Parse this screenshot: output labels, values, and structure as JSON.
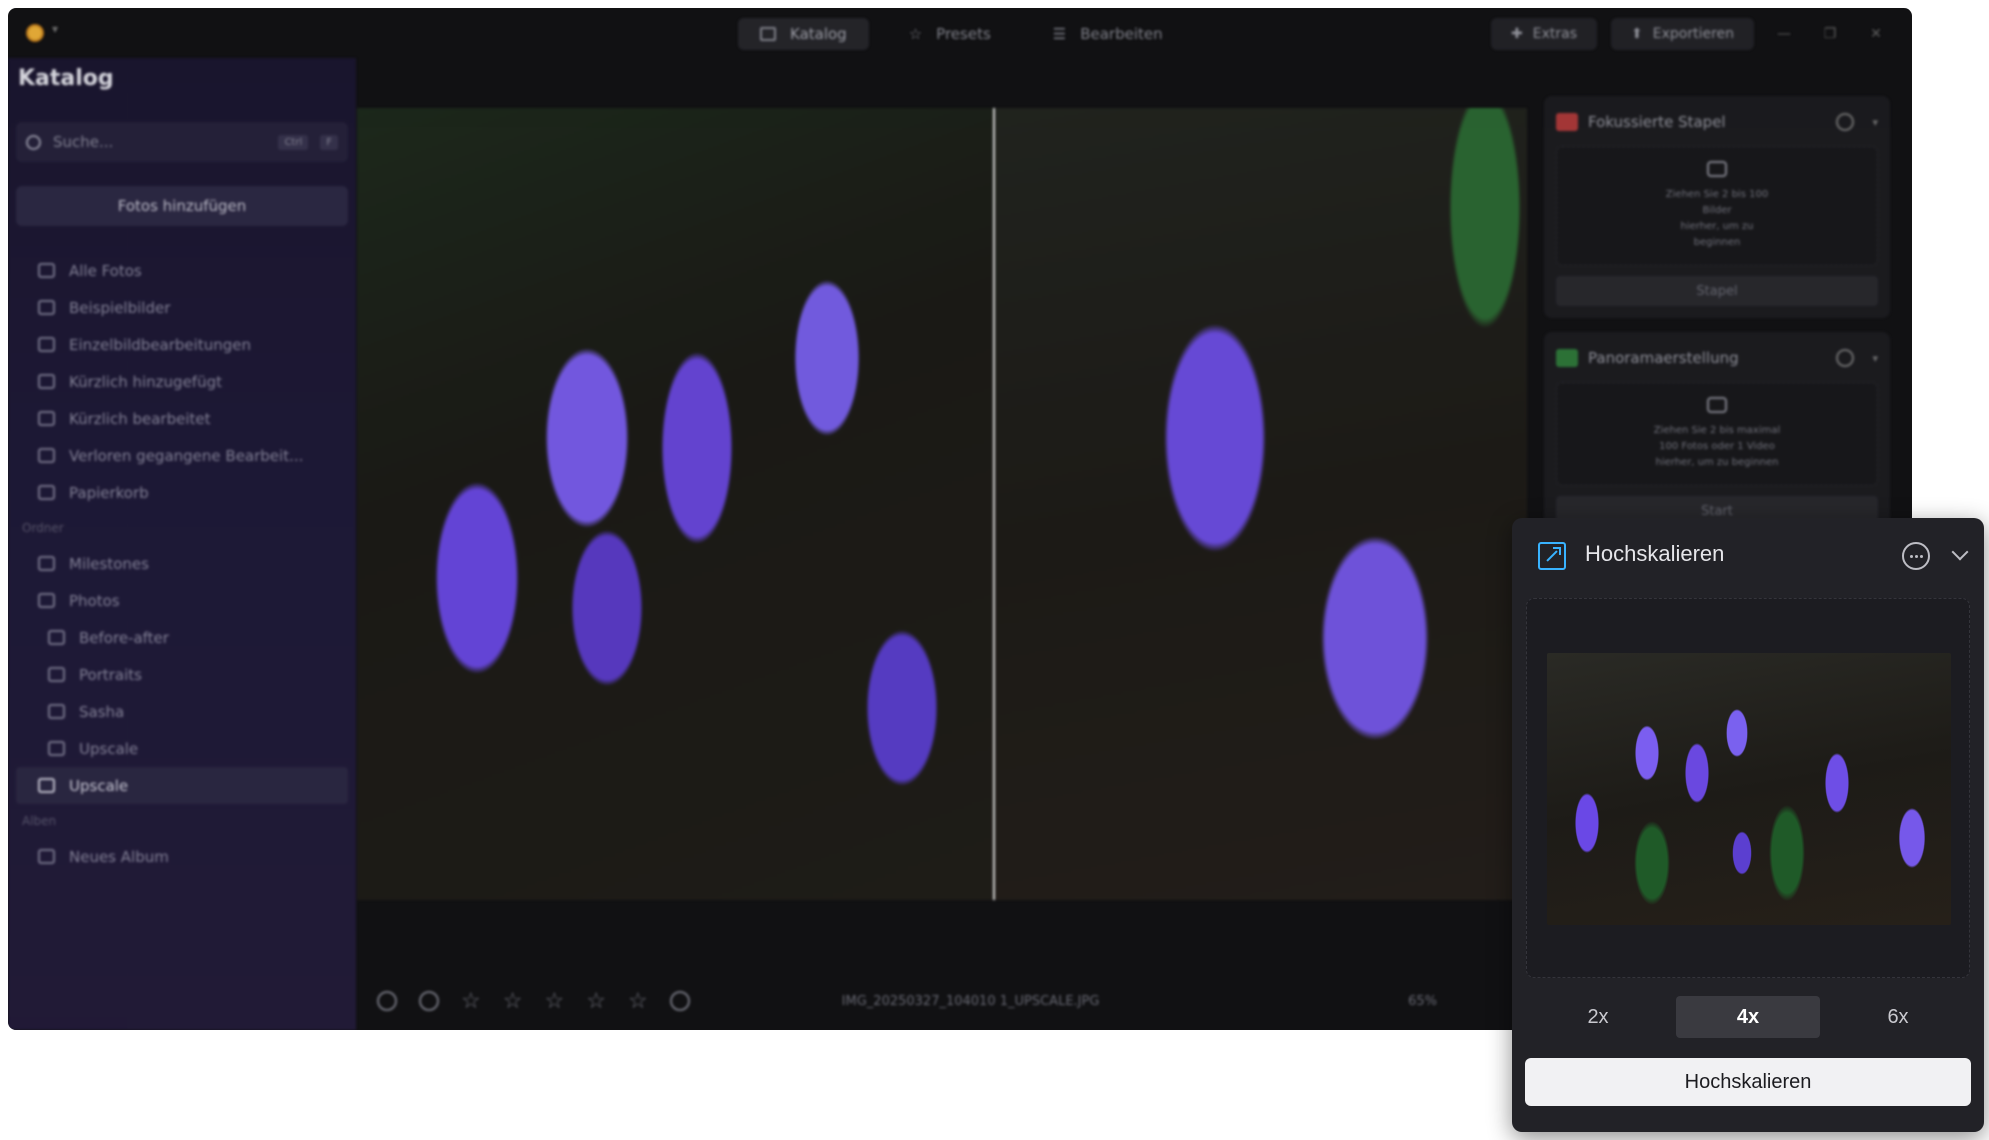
{
  "titlebar": {
    "tabs": [
      {
        "label": "Katalog",
        "active": true,
        "icon": "folder-icon"
      },
      {
        "label": "Presets",
        "active": false,
        "icon": "sparkle-icon"
      },
      {
        "label": "Bearbeiten",
        "active": false,
        "icon": "sliders-icon"
      }
    ],
    "extras_label": "Extras",
    "export_label": "Exportieren"
  },
  "sidebar": {
    "title": "Katalog",
    "search": {
      "placeholder": "Suche...",
      "shortcut": "Ctrl",
      "shortcut2": "F"
    },
    "add_photos_label": "Fotos hinzufügen",
    "items": [
      {
        "label": "Alle Fotos",
        "icon": "photos-icon"
      },
      {
        "label": "Beispielbilder",
        "icon": "examples-icon"
      },
      {
        "label": "Einzelbildbearbeitungen",
        "icon": "grid-icon"
      },
      {
        "label": "Kürzlich hinzugefügt",
        "icon": "recent-add-icon"
      },
      {
        "label": "Kürzlich bearbeitet",
        "icon": "recent-edit-icon"
      },
      {
        "label": "Verloren gegangene Bearbeit...",
        "icon": "lost-icon"
      },
      {
        "label": "Papierkorb",
        "icon": "trash-icon"
      }
    ],
    "ordner_label": "Ordner",
    "folders": [
      {
        "label": "Milestones",
        "sub": false
      },
      {
        "label": "Photos",
        "sub": false
      },
      {
        "label": "Before-after",
        "sub": true
      },
      {
        "label": "Portraits",
        "sub": true
      },
      {
        "label": "Sasha",
        "sub": true
      },
      {
        "label": "Upscale",
        "sub": true
      }
    ],
    "active_folder": "Upscale",
    "alben_label": "Alben",
    "albums": [
      {
        "label": "Neues Album"
      }
    ]
  },
  "bottom_bar": {
    "rating_stars": 0,
    "filename": "IMG_20250327_104010 1_UPSCALE.JPG",
    "zoom": "65%"
  },
  "right_panel": {
    "cards": [
      {
        "title": "Fokussierte Stapel",
        "lines": [
          "Ziehen Sie 2 bis 100",
          "Bilder",
          "hierher, um zu",
          "beginnen"
        ],
        "button": "Stapel"
      },
      {
        "title": "Panoramaerstellung",
        "lines": [
          "Ziehen Sie 2 bis maximal",
          "100 Fotos oder 1 Video",
          "hierher, um zu beginnen"
        ],
        "button": "Start"
      }
    ]
  },
  "popup": {
    "title": "Hochskalieren",
    "scale_options": [
      "2x",
      "4x",
      "6x"
    ],
    "selected_scale": "4x",
    "action_label": "Hochskalieren",
    "accent_color": "#39b3ff"
  }
}
